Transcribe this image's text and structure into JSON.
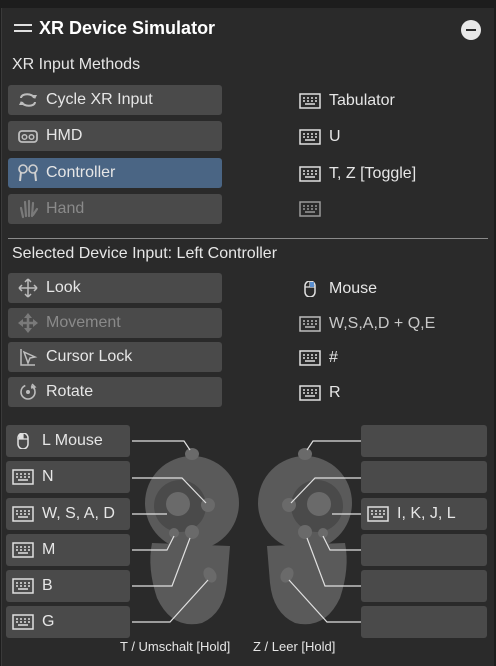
{
  "window": {
    "title": "XR Device Simulator"
  },
  "input_methods": {
    "heading": "XR Input Methods",
    "items": [
      {
        "label": "Cycle XR Input",
        "key": "Tabulator",
        "icon": "cycle-icon",
        "state": "normal"
      },
      {
        "label": "HMD",
        "key": "U",
        "icon": "hmd-icon",
        "state": "normal"
      },
      {
        "label": "Controller",
        "key": "T, Z [Toggle]",
        "icon": "controller-icon",
        "state": "active"
      },
      {
        "label": "Hand",
        "key": "",
        "icon": "hand-icon",
        "state": "disabled"
      }
    ]
  },
  "device_input": {
    "heading": "Selected Device Input: Left Controller",
    "items": [
      {
        "label": "Look",
        "key": "Mouse",
        "icon": "move-arrows-icon",
        "key_icon": "mouse-icon",
        "state": "normal"
      },
      {
        "label": "Movement",
        "key": "W,S,A,D + Q,E",
        "icon": "move-arrows-icon",
        "key_icon": "keyboard-icon",
        "state": "disabled"
      },
      {
        "label": "Cursor Lock",
        "key": "#",
        "icon": "cursor-icon",
        "key_icon": "keyboard-icon",
        "state": "normal"
      },
      {
        "label": "Rotate",
        "key": "R",
        "icon": "rotate-icon",
        "key_icon": "keyboard-icon",
        "state": "normal"
      }
    ]
  },
  "left_controller": {
    "buttons": [
      {
        "label": "L Mouse",
        "icon": "mouse-icon"
      },
      {
        "label": "N",
        "icon": "keyboard-icon"
      },
      {
        "label": "W, S, A, D",
        "icon": "keyboard-icon"
      },
      {
        "label": "M",
        "icon": "keyboard-icon"
      },
      {
        "label": "B",
        "icon": "keyboard-icon"
      },
      {
        "label": "G",
        "icon": "keyboard-icon"
      }
    ]
  },
  "right_controller": {
    "buttons": [
      {
        "label": ""
      },
      {
        "label": ""
      },
      {
        "label": "I, K, J, L",
        "icon": "keyboard-icon"
      },
      {
        "label": ""
      },
      {
        "label": ""
      },
      {
        "label": ""
      }
    ]
  },
  "footer": {
    "left_hold": "T / Umschalt [Hold]",
    "right_hold": "Z / Leer [Hold]"
  },
  "colors": {
    "panel": "#2a2a2a",
    "button": "#4a4a4a",
    "active": "#4a6584",
    "text": "#e6e6e6"
  }
}
